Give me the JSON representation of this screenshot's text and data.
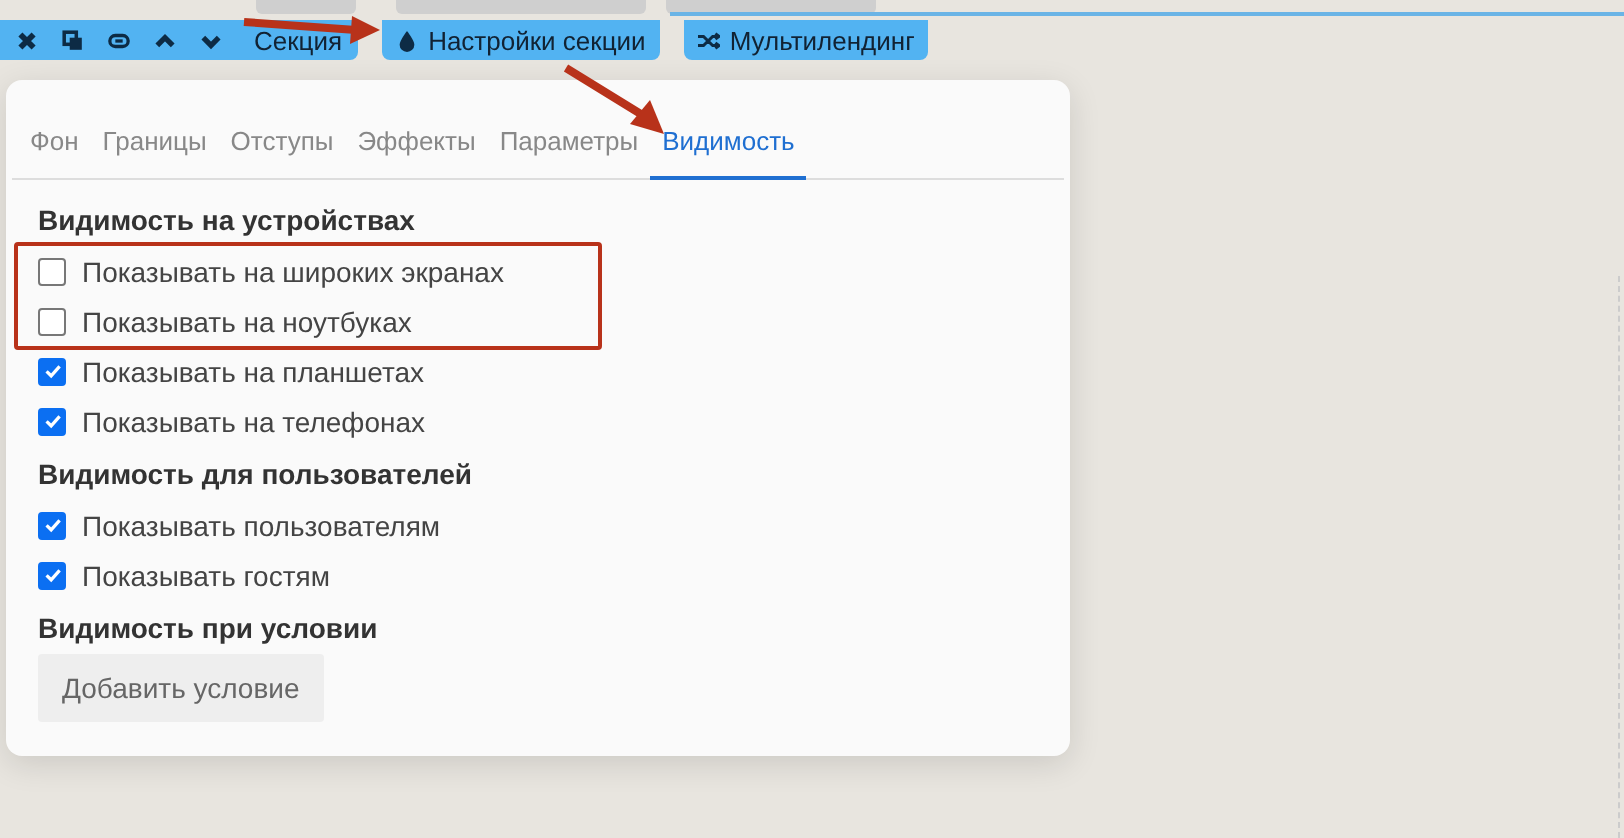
{
  "toolbar": {
    "section_label": "Секция",
    "settings_button": "Настройки секции",
    "multilanding_button": "Мультилендинг"
  },
  "panel": {
    "tabs": [
      {
        "label": "Фон",
        "selected": false
      },
      {
        "label": "Границы",
        "selected": false
      },
      {
        "label": "Отступы",
        "selected": false
      },
      {
        "label": "Эффекты",
        "selected": false
      },
      {
        "label": "Параметры",
        "selected": false
      },
      {
        "label": "Видимость",
        "selected": true
      }
    ],
    "groups": [
      {
        "heading": "Видимость на устройствах",
        "options": [
          {
            "label": "Показывать на широких экранах",
            "checked": false
          },
          {
            "label": "Показывать на ноутбуках",
            "checked": false
          },
          {
            "label": "Показывать на планшетах",
            "checked": true
          },
          {
            "label": "Показывать на телефонах",
            "checked": true
          }
        ]
      },
      {
        "heading": "Видимость для пользователей",
        "options": [
          {
            "label": "Показывать пользователям",
            "checked": true
          },
          {
            "label": "Показывать гостям",
            "checked": true
          }
        ]
      },
      {
        "heading": "Видимость при условии"
      }
    ],
    "add_condition_button": "Добавить условие"
  }
}
